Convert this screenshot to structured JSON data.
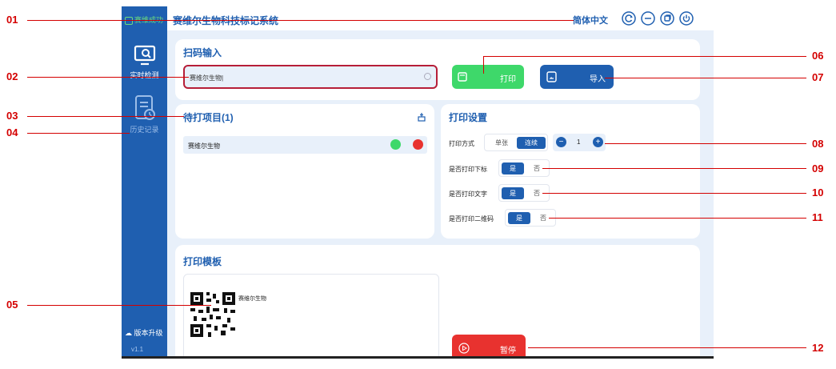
{
  "callouts": {
    "n01": "01",
    "n02": "02",
    "n03": "03",
    "n04": "04",
    "n05": "05",
    "n06": "06",
    "n07": "07",
    "n08": "08",
    "n09": "09",
    "n10": "10",
    "n11": "11",
    "n12": "12"
  },
  "app": {
    "logo_text": "赛维成功",
    "title": "赛维尔生物科技标记系统",
    "language": "简体中文",
    "window_buttons": [
      "refresh-icon",
      "minimize-icon",
      "restore-icon",
      "power-icon"
    ]
  },
  "sidebar": {
    "items": [
      {
        "label": "实时检测",
        "icon": "monitor-search-icon"
      },
      {
        "label": "历史记录",
        "icon": "history-document-icon"
      }
    ],
    "upgrade_label": "版本升级",
    "version": "v1.1"
  },
  "scan": {
    "title": "扫码输入",
    "input_value": "赛维尔生物|",
    "print_label": "打印",
    "import_label": "导入"
  },
  "pending": {
    "title": "待打项目(1)",
    "items": [
      {
        "name": "赛维尔生物"
      }
    ]
  },
  "settings": {
    "title": "打印设置",
    "print_mode_label": "打印方式",
    "single_label": "单张",
    "continuous_label": "连续",
    "quantity": "1",
    "print_subscript_label": "是否打印下标",
    "print_text_label": "是否打印文字",
    "print_qr_label": "是否打印二维码",
    "yes": "是",
    "no": "否"
  },
  "template": {
    "title": "打印模板",
    "label_text": "赛维尔生物",
    "pause_label": "暂停"
  },
  "colors": {
    "primary": "#1f5fb0",
    "success": "#3ed86a",
    "danger": "#e8322f",
    "callout": "#d40000"
  }
}
